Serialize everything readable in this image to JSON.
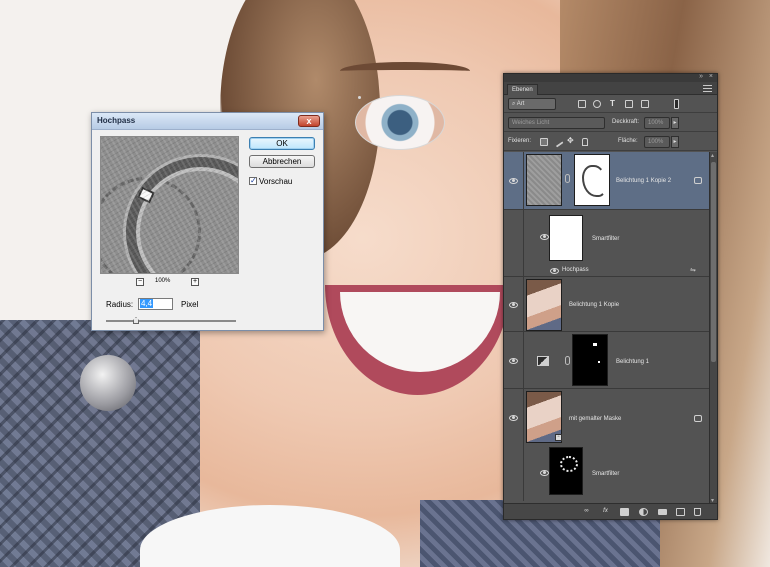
{
  "dialog": {
    "title": "Hochpass",
    "ok_label": "OK",
    "cancel_label": "Abbrechen",
    "preview_label": "Vorschau",
    "preview_checked": true,
    "zoom": "100%",
    "zoom_minus": "−",
    "zoom_plus": "+",
    "radius_label": "Radius:",
    "radius_value": "4,4",
    "radius_unit": "Pixel",
    "close_glyph": "x"
  },
  "panel": {
    "tab": "Ebenen",
    "filter_type": "Art",
    "blend_mode": "Weiches Licht",
    "opacity_label": "Deckkraft:",
    "opacity_value": "100%",
    "lock_label": "Fixieren:",
    "fill_label": "Fläche:",
    "fill_value": "100%",
    "layers": [
      {
        "name": "Belichtung 1 Kopie 2",
        "selected": true
      },
      {
        "name": "Smartfilter"
      },
      {
        "name": "Hochpass"
      },
      {
        "name": "Belichtung 1 Kopie"
      },
      {
        "name": "Belichtung 1"
      },
      {
        "name": "mit gemalter Maske"
      },
      {
        "name": "Smartfilter"
      }
    ],
    "bottom_icons": [
      "link-icon",
      "fx-icon",
      "mask-icon",
      "adjustment-icon",
      "folder-icon",
      "new-layer-icon",
      "trash-icon"
    ]
  },
  "colors": {
    "panel_bg": "#535353",
    "selected_layer": "#5e6e86",
    "dialog_bg": "#f0f0f0"
  }
}
